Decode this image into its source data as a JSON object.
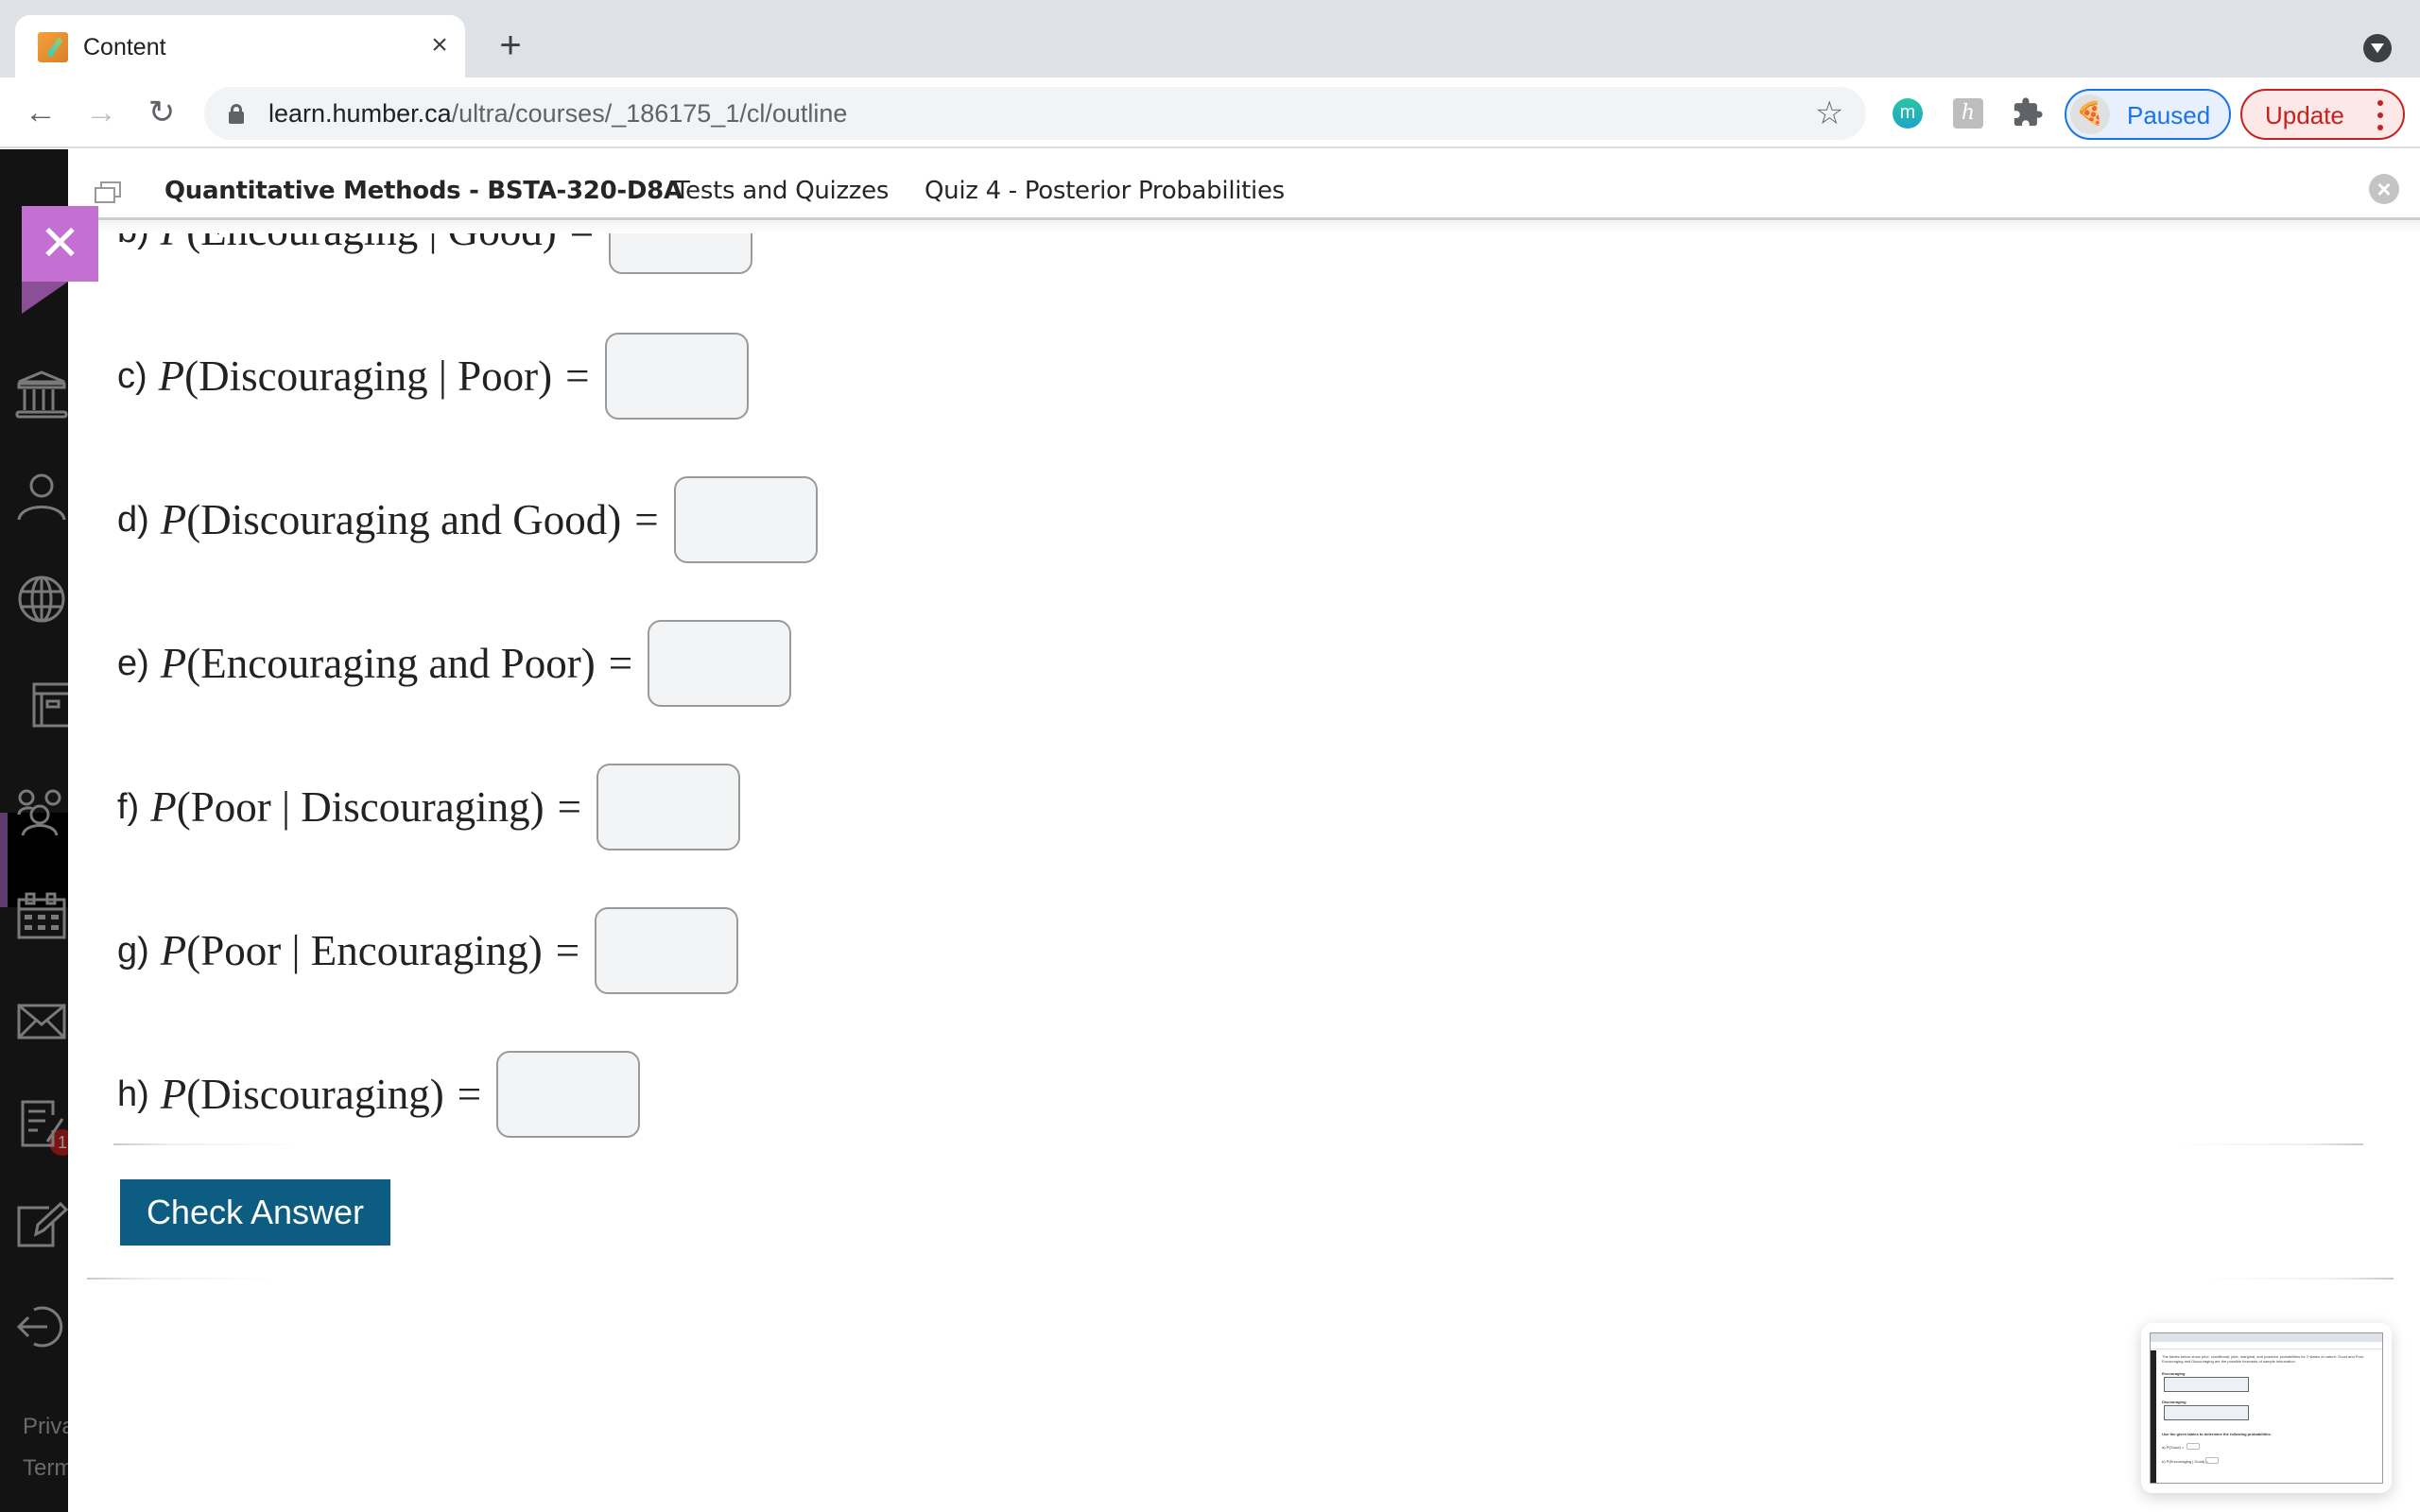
{
  "browser": {
    "tab": {
      "title": "Content",
      "close_glyph": "×",
      "favicon": "pencil-icon"
    },
    "new_tab_glyph": "+",
    "nav": {
      "back_glyph": "←",
      "forward_glyph": "→",
      "reload_glyph": "↻"
    },
    "url": {
      "host": "learn.humber.ca",
      "path": "/ultra/courses/_186175_1/cl/outline"
    },
    "star_glyph": "☆",
    "extensions": {
      "m_label": "m",
      "h_label": "h"
    },
    "profile": {
      "label": "Paused",
      "avatar_glyph": "🍕"
    },
    "update": {
      "label": "Update"
    }
  },
  "sidebar": {
    "items": [
      {
        "name": "institution",
        "icon": "institution-icon"
      },
      {
        "name": "profile",
        "icon": "person-icon"
      },
      {
        "name": "activity",
        "icon": "globe-icon"
      },
      {
        "name": "courses",
        "icon": "courses-icon",
        "active": true
      },
      {
        "name": "organizations",
        "icon": "groups-icon"
      },
      {
        "name": "calendar",
        "icon": "calendar-icon"
      },
      {
        "name": "messages",
        "icon": "mail-icon",
        "badge": "1"
      },
      {
        "name": "grades",
        "icon": "grades-icon"
      },
      {
        "name": "tools",
        "icon": "edit-icon"
      },
      {
        "name": "sign-out",
        "icon": "sign-out-icon"
      }
    ],
    "mail_badge": "1",
    "footer": {
      "privacy": "Privacy",
      "terms": "Terms"
    }
  },
  "panel": {
    "breadcrumb": {
      "course": "Quantitative Methods - BSTA-320-D8A",
      "section": "Tests and Quizzes",
      "item": "Quiz 4 - Posterior Probabilities"
    },
    "close_glyph": "×",
    "close_tab_glyph": "✕"
  },
  "questions": [
    {
      "letter": "b)",
      "P": "P",
      "expr": "(Encouraging | Good)",
      "eq": "=",
      "value": ""
    },
    {
      "letter": "c)",
      "P": "P",
      "expr": "(Discouraging | Poor)",
      "eq": "=",
      "value": ""
    },
    {
      "letter": "d)",
      "P": "P",
      "expr": "(Discouraging and Good)",
      "eq": "=",
      "value": ""
    },
    {
      "letter": "e)",
      "P": "P",
      "expr": "(Encouraging and Poor)",
      "eq": "=",
      "value": ""
    },
    {
      "letter": "f)",
      "P": "P",
      "expr": "(Poor | Discouraging)",
      "eq": "=",
      "value": ""
    },
    {
      "letter": "g)",
      "P": "P",
      "expr": "(Poor | Encouraging)",
      "eq": "=",
      "value": ""
    },
    {
      "letter": "h)",
      "P": "P",
      "expr": "(Discouraging)",
      "eq": "=",
      "value": ""
    }
  ],
  "check_answer_label": "Check Answer",
  "thumbnail": {
    "intro": "The tables below show prior, conditional, joint, marginal, and posterior probabilities for 2 states of nature: Good and Poor. Encouraging and Discouraging are the possible forecasts of sample information.",
    "table1_title": "Encouraging",
    "table2_title": "Discouraging",
    "instruction": "Use the given tables to determine the following probabilities:",
    "q_a": "a) P(Good) =",
    "q_b": "b) P(Encouraging | Good) ="
  },
  "colors": {
    "accent_purple": "#c46fd2",
    "button_blue": "#0d5c82",
    "sidebar_bg": "#131313",
    "paused_blue": "#1a73e8",
    "update_red": "#c5221f"
  }
}
